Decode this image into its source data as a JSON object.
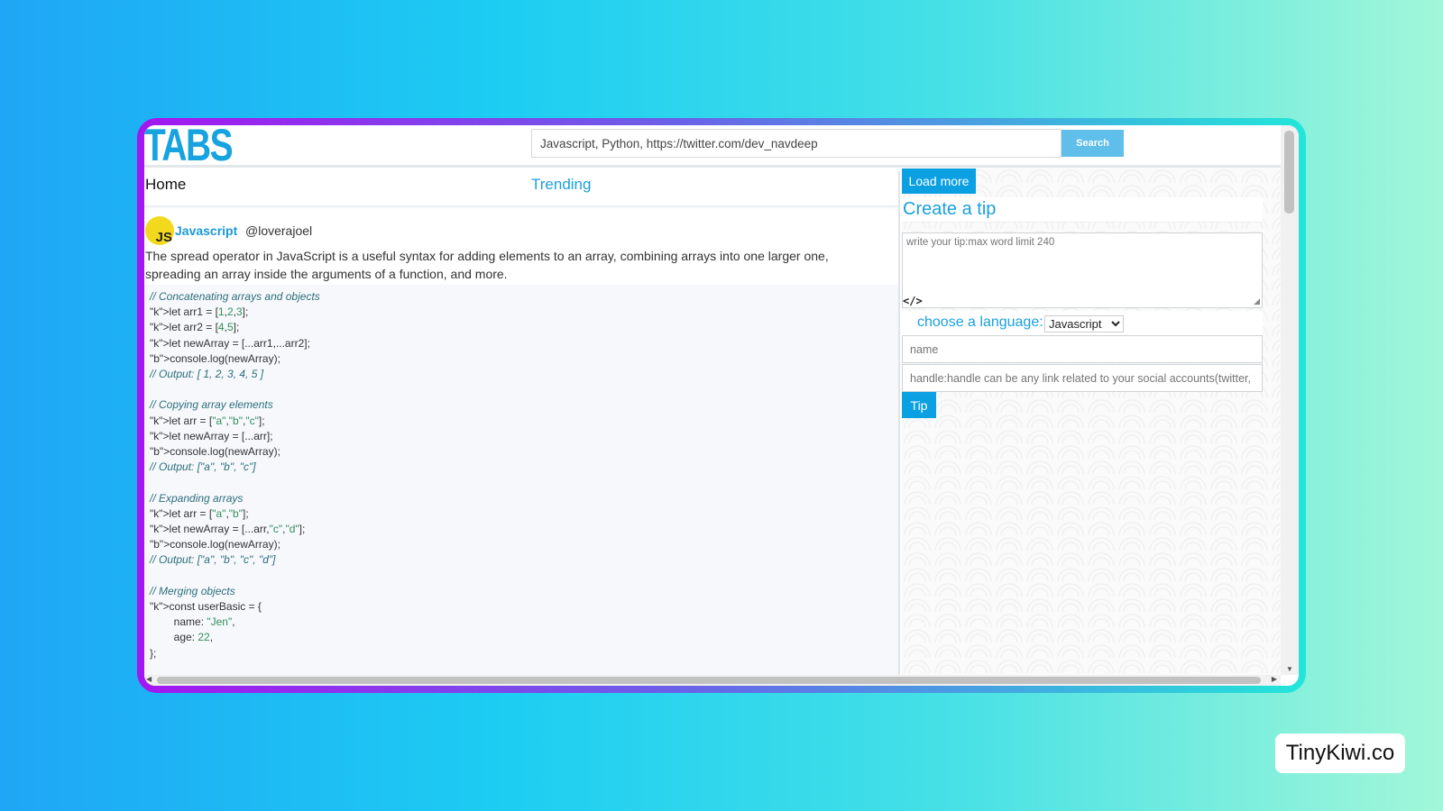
{
  "app": {
    "logo": "TABS"
  },
  "search": {
    "value": "Javascript, Python, https://twitter.com/dev_navdeep",
    "button_label": "Search"
  },
  "nav": {
    "home": "Home",
    "trending": "Trending"
  },
  "post": {
    "avatar_text": "JS",
    "language": "Javascript",
    "handle": "@loverajoel",
    "text": "The spread operator in JavaScript is a useful syntax for adding elements to an array, combining arrays into one larger one, spreading an array inside the arguments of a function, and more.",
    "code_lines": [
      "// Concatenating arrays and objects",
      "let arr1 = [1,2,3];",
      "let arr2 = [4,5];",
      "let newArray = [...arr1,...arr2];",
      "console.log(newArray);",
      "// Output: [ 1, 2, 3, 4, 5 ]",
      "",
      "// Copying array elements",
      "let arr = [\"a\",\"b\",\"c\"];",
      "let newArray = [...arr];",
      "console.log(newArray);",
      "// Output: [\"a\", \"b\", \"c\"]",
      "",
      "// Expanding arrays",
      "let arr = [\"a\",\"b\"];",
      "let newArray = [...arr,\"c\",\"d\"];",
      "console.log(newArray);",
      "// Output: [\"a\", \"b\", \"c\", \"d\"]",
      "",
      "// Merging objects",
      "const userBasic = {",
      "        name: \"Jen\",",
      "        age: 22,",
      "};"
    ]
  },
  "sidebar": {
    "load_more_label": "Load more",
    "create_title": "Create a tip",
    "tip_placeholder": "write your tip:max word limit 240",
    "code_icon": "</>",
    "language_label": "choose a language:",
    "language_selected": "Javascript",
    "name_placeholder": "name",
    "handle_placeholder": "handle:handle can be any link related to your social accounts(twitter, face",
    "tip_button_label": "Tip"
  },
  "watermark": "TinyKiwi.co",
  "colors": {
    "accent": "#1aa0dc",
    "button": "#0ba0e2",
    "search_button": "#5fbfea",
    "avatar": "#f3d91d"
  }
}
